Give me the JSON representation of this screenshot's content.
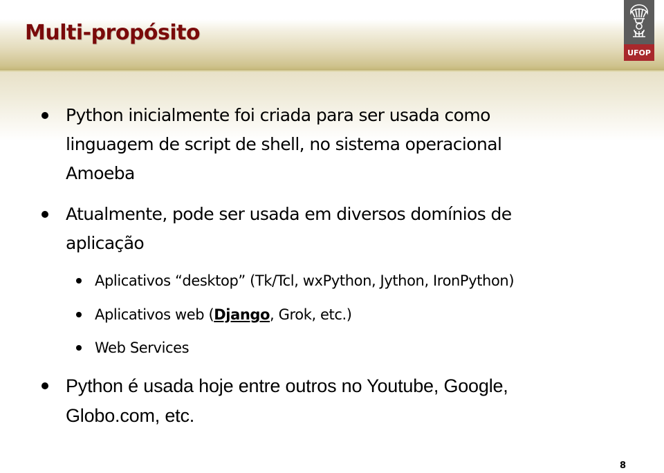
{
  "slide": {
    "title": "Multi-propósito",
    "page_number": "8",
    "logo": {
      "text": "UFOP",
      "icon": "ufop-emblem-icon",
      "colors": {
        "top": "#5c5c5c",
        "bottom": "#a8282c"
      }
    },
    "colors": {
      "title": "#7a0a0a",
      "header_band": "#cfc38e"
    }
  },
  "bullets": [
    {
      "lines": [
        "Python inicialmente foi criada para ser usada como",
        "linguagem de script de shell, no sistema operacional",
        "Amoeba"
      ]
    },
    {
      "lines": [
        "Atualmente, pode ser usada em diversos domínios de",
        "aplicação"
      ],
      "sub_bullets": [
        {
          "text": "Aplicativos “desktop” (Tk/Tcl,  wxPython, Jython, IronPython)"
        },
        {
          "prefix": "Aplicativos web (",
          "emphasis": "Django",
          "suffix": ", Grok, etc.)"
        },
        {
          "text": "Web Services"
        }
      ]
    },
    {
      "lines": [
        "Python é usada hoje entre outros no Youtube, Google,",
        "Globo.com, etc."
      ]
    }
  ]
}
